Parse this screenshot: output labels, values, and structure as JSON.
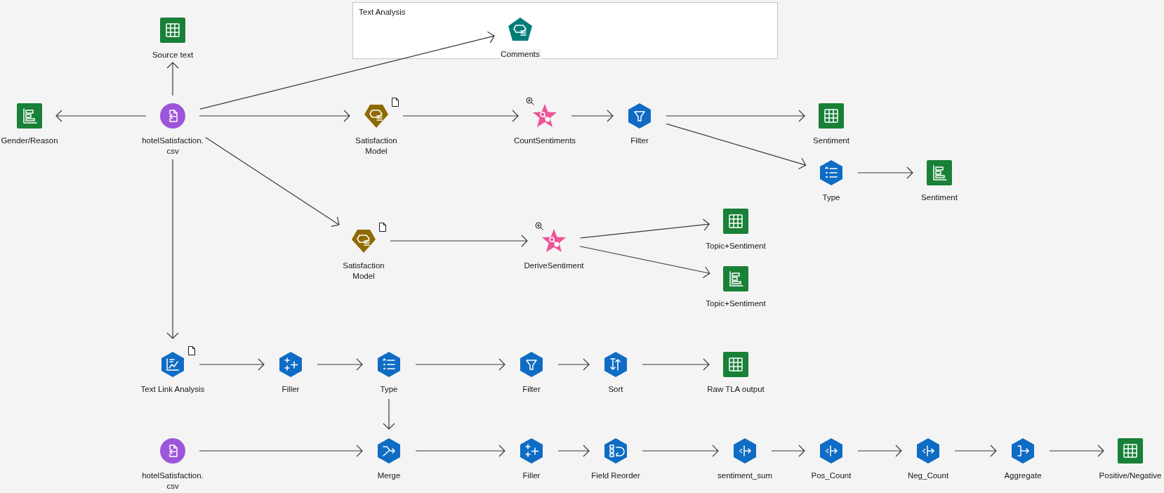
{
  "group": {
    "title": "Text Analysis"
  },
  "nodes": [
    {
      "label": "Source text",
      "kind": "table"
    },
    {
      "label": "Comments",
      "kind": "text-model"
    },
    {
      "label": "Gender/Reason",
      "kind": "chart"
    },
    {
      "label": "hotelSatisfaction.\ncsv",
      "kind": "source"
    },
    {
      "label": "Satisfaction\nModel",
      "kind": "model",
      "document_badge": true
    },
    {
      "label": "CountSentiments",
      "kind": "star",
      "zoom_badge": true
    },
    {
      "label": "Filter",
      "kind": "filter"
    },
    {
      "label": "Sentiment",
      "kind": "table"
    },
    {
      "label": "Type",
      "kind": "type"
    },
    {
      "label": "Sentiment",
      "kind": "chart"
    },
    {
      "label": "Satisfaction\nModel",
      "kind": "model",
      "document_badge": true
    },
    {
      "label": "DeriveSentiment",
      "kind": "star",
      "zoom_badge": true
    },
    {
      "label": "Topic+Sentiment",
      "kind": "table"
    },
    {
      "label": "Topic+Sentiment",
      "kind": "chart"
    },
    {
      "label": "Text Link Analysis",
      "kind": "tla",
      "document_badge": true
    },
    {
      "label": "Filler",
      "kind": "filler"
    },
    {
      "label": "Type",
      "kind": "type"
    },
    {
      "label": "Filter",
      "kind": "filter"
    },
    {
      "label": "Sort",
      "kind": "sort"
    },
    {
      "label": "Raw TLA output",
      "kind": "table"
    },
    {
      "label": "hotelSatisfaction.\ncsv",
      "kind": "source"
    },
    {
      "label": "Merge",
      "kind": "merge"
    },
    {
      "label": "Filler",
      "kind": "filler"
    },
    {
      "label": "Field Reorder",
      "kind": "reorder"
    },
    {
      "label": "sentiment_sum",
      "kind": "derive"
    },
    {
      "label": "Pos_Count",
      "kind": "derive"
    },
    {
      "label": "Neg_Count",
      "kind": "derive"
    },
    {
      "label": "Aggregate",
      "kind": "aggregate"
    },
    {
      "label": "Positive/Negative",
      "kind": "table"
    }
  ]
}
